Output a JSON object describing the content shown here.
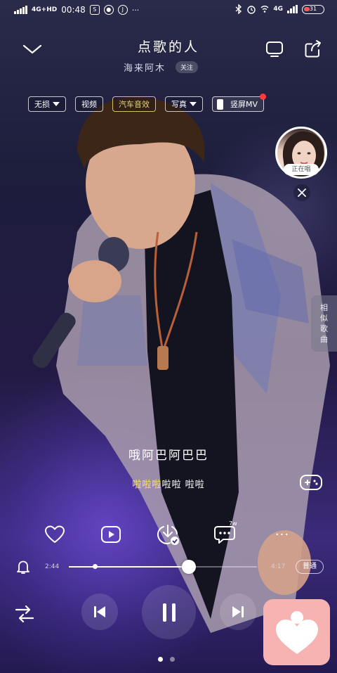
{
  "status_bar": {
    "network": "4G+HD",
    "time": "00:48",
    "network_right": "4G",
    "battery": "31",
    "more": "···"
  },
  "header": {
    "song_title": "点歌的人",
    "artist": "海来阿木",
    "follow_label": "关注"
  },
  "tags": {
    "sound": "无损",
    "video": "视频",
    "car_audio": "汽车音效",
    "photo": "写真",
    "vertical_mv": "竖屏MV"
  },
  "singer_bubble": {
    "label": "正在唱"
  },
  "similar_tab": {
    "label": "相似歌曲"
  },
  "lyrics": {
    "current": "哦阿巴阿巴巴",
    "next_highlight": "啦啦啦",
    "next_rest": "啦啦 啦啦"
  },
  "actions": {
    "comment_count": "7w",
    "more": "···"
  },
  "progress": {
    "elapsed": "2:44",
    "total": "4:17",
    "played_fraction": 0.6381,
    "quality_label": "普通"
  },
  "pager": {
    "pages": 2,
    "current": 1
  },
  "colors": {
    "accent_lyric": "#ffe25a",
    "gold_tag": "#d8c06a",
    "fab_bg": "#f7b2b2",
    "notify_dot": "#ff3b3b"
  }
}
